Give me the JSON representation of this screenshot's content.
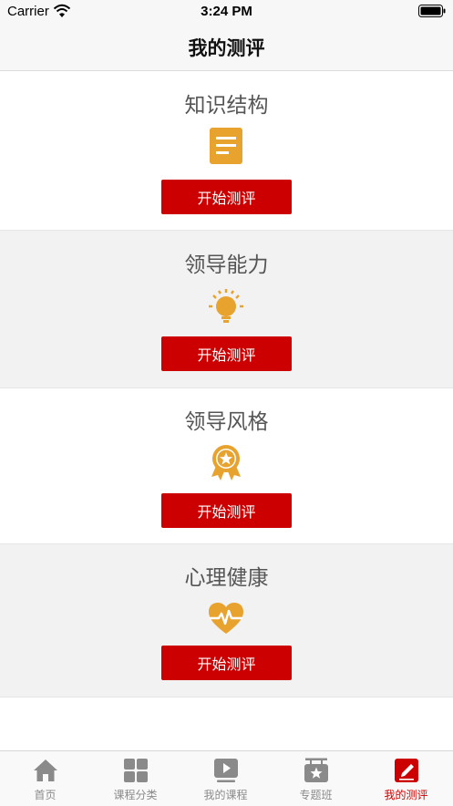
{
  "status": {
    "carrier": "Carrier",
    "time": "3:24 PM"
  },
  "nav": {
    "title": "我的测评"
  },
  "sections": [
    {
      "title": "知识结构",
      "icon": "document-icon",
      "button": "开始测评"
    },
    {
      "title": "领导能力",
      "icon": "lightbulb-icon",
      "button": "开始测评"
    },
    {
      "title": "领导风格",
      "icon": "award-badge-icon",
      "button": "开始测评"
    },
    {
      "title": "心理健康",
      "icon": "heart-pulse-icon",
      "button": "开始测评"
    }
  ],
  "tabs": [
    {
      "label": "首页",
      "icon": "home-icon"
    },
    {
      "label": "课程分类",
      "icon": "grid-icon"
    },
    {
      "label": "我的课程",
      "icon": "video-play-icon"
    },
    {
      "label": "专题班",
      "icon": "star-board-icon"
    },
    {
      "label": "我的测评",
      "icon": "evaluation-icon",
      "active": true
    }
  ],
  "colors": {
    "accent": "#cc0000",
    "icon_orange": "#e8a22e",
    "tab_inactive": "#8a8a8a"
  }
}
